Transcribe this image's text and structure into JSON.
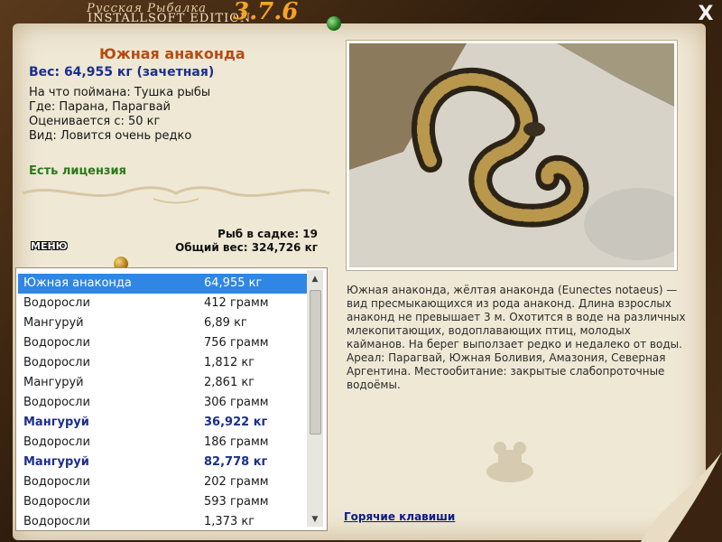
{
  "header": {
    "title": "Русская Рыбалка",
    "edition": "INSTALLSOFT EDITION",
    "version": "3.7.6",
    "close_label": "X"
  },
  "fish": {
    "name": "Южная анаконда",
    "weight": "Вес: 64,955 кг (зачетная)",
    "caught_on": "На что поймана: Тушка рыбы",
    "location": "Где: Парана, Парагвай",
    "min_weight": "Оценивается с: 50 кг",
    "rarity": "Вид: Ловится очень редко",
    "license": "Есть лицензия",
    "description": "Южная анаконда, жёлтая анаконда (Eunectes notaeus) — вид пресмыкающихся из рода анаконд. Длина взрослых анаконд не превышает 3 м. Охотится в воде на различных млекопитающих, водоплавающих птиц, молодых кайманов. На берег выползает редко и недалеко от воды. Ареал: Парагвай, Южная Боливия, Амазония, Северная Аргентина. Местообитание: закрытые слабопроточные водоёмы."
  },
  "menu_label": "МЕНЮ",
  "stats": {
    "count": "Рыб в садке: 19",
    "total": "Общий вес: 324,726 кг"
  },
  "catch_list": [
    {
      "name": "Южная анаконда",
      "weight": "64,955 кг"
    },
    {
      "name": "Водоросли",
      "weight": "412 грамм"
    },
    {
      "name": "Мангуруй",
      "weight": "6,89 кг"
    },
    {
      "name": "Водоросли",
      "weight": "756 грамм"
    },
    {
      "name": "Водоросли",
      "weight": "1,812 кг"
    },
    {
      "name": "Мангуруй",
      "weight": "2,861 кг"
    },
    {
      "name": "Водоросли",
      "weight": "306 грамм"
    },
    {
      "name": "Мангуруй",
      "weight": "36,922 кг"
    },
    {
      "name": "Водоросли",
      "weight": "186 грамм"
    },
    {
      "name": "Мангуруй",
      "weight": "82,778 кг"
    },
    {
      "name": "Водоросли",
      "weight": "202 грамм"
    },
    {
      "name": "Водоросли",
      "weight": "593 грамм"
    },
    {
      "name": "Водоросли",
      "weight": "1,373 кг"
    }
  ],
  "hotkeys_label": "Горячие клавиши",
  "colors": {
    "selected_row": "#2f86e3",
    "trophy_text": "#1b2f8c",
    "fish_title": "#b84a14",
    "license": "#2a7a18"
  }
}
